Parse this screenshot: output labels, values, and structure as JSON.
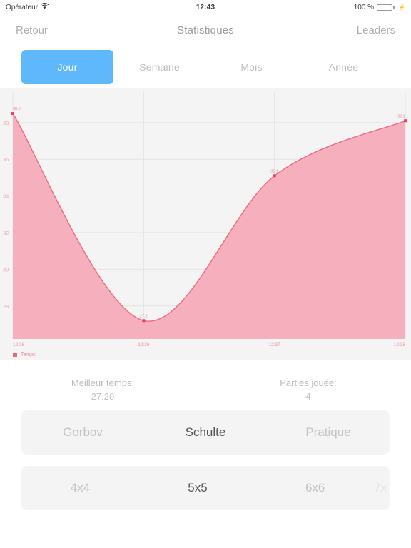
{
  "status_bar": {
    "carrier": "Opérateur",
    "wifi_icon": "wifi-icon",
    "time": "12:43",
    "battery_percent": "100 %",
    "battery_icon": "battery-full-icon",
    "charging_icon": "lightning-bolt-icon"
  },
  "nav": {
    "back_label": "Retour",
    "title": "Statistiques",
    "leaders_label": "Leaders"
  },
  "period_tabs": [
    {
      "label": "Jour",
      "active": true
    },
    {
      "label": "Semaine",
      "active": false
    },
    {
      "label": "Mois",
      "active": false
    },
    {
      "label": "Année",
      "active": false
    }
  ],
  "colors": {
    "accent_blue": "#5fb8fc",
    "series_line": "#ef6a85",
    "series_fill": "#f5afbd",
    "chart_background": "#f4f4f4",
    "plot_background": "#f4f4f4",
    "battery_green": "#4cd964"
  },
  "chart_data": {
    "type": "area",
    "title": "",
    "xlabel": "",
    "ylabel": "",
    "x": [
      "12:36",
      "12:36",
      "12:37",
      "12:38"
    ],
    "xtick_labels": [
      "12:36",
      "12:36",
      "12:37",
      "12:38"
    ],
    "values": [
      38.5,
      27.2,
      35.1,
      38.1
    ],
    "point_labels": [
      "38.5",
      "27.2",
      "35.1",
      "38.1"
    ],
    "ytick_labels": [
      "38",
      "36",
      "34",
      "32",
      "30",
      "28"
    ],
    "ytick_values": [
      38,
      36,
      34,
      32,
      30,
      28
    ],
    "ylim": [
      26.2,
      39.2
    ],
    "grid": true,
    "fill_below": true,
    "smoothing": "spline",
    "legend": {
      "position": "bottom-left",
      "entries": [
        "Temps"
      ]
    },
    "series": [
      {
        "name": "Temps",
        "values": [
          38.5,
          27.2,
          35.1,
          38.1
        ]
      }
    ]
  },
  "stats": [
    {
      "label": "Meilleur temps:",
      "value": "27.20"
    },
    {
      "label": "Parties jouée:",
      "value": "4"
    }
  ],
  "mode_selector": [
    {
      "label": "Gorbov",
      "selected": false
    },
    {
      "label": "Schulte",
      "selected": true
    },
    {
      "label": "Pratique",
      "selected": false
    }
  ],
  "size_selector": [
    {
      "label": "4x4",
      "selected": false
    },
    {
      "label": "5x5",
      "selected": true
    },
    {
      "label": "6x6",
      "selected": false
    },
    {
      "label": "7x",
      "selected": false
    }
  ]
}
